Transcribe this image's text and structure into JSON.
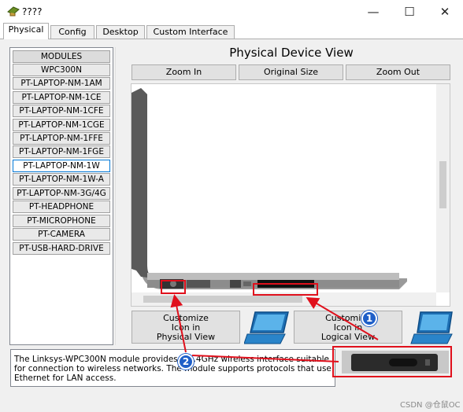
{
  "window": {
    "title": "????",
    "minimize_glyph": "—",
    "maximize_glyph": "☐",
    "close_glyph": "✕"
  },
  "tabs": [
    {
      "label": "Physical",
      "active": true
    },
    {
      "label": "Config",
      "active": false
    },
    {
      "label": "Desktop",
      "active": false
    },
    {
      "label": "Custom Interface",
      "active": false
    }
  ],
  "modules": {
    "header": "MODULES",
    "items": [
      "WPC300N",
      "PT-LAPTOP-NM-1AM",
      "PT-LAPTOP-NM-1CE",
      "PT-LAPTOP-NM-1CFE",
      "PT-LAPTOP-NM-1CGE",
      "PT-LAPTOP-NM-1FFE",
      "PT-LAPTOP-NM-1FGE",
      "PT-LAPTOP-NM-1W",
      "PT-LAPTOP-NM-1W-A",
      "PT-LAPTOP-NM-3G/4G",
      "PT-HEADPHONE",
      "PT-MICROPHONE",
      "PT-CAMERA",
      "PT-USB-HARD-DRIVE"
    ],
    "selected": "PT-LAPTOP-NM-1W"
  },
  "physical_view": {
    "title": "Physical Device View",
    "zoom_in": "Zoom In",
    "original_size": "Original Size",
    "zoom_out": "Zoom Out"
  },
  "customize": {
    "physical": {
      "line1": "Customize",
      "line2": "Icon in",
      "line3": "Physical View"
    },
    "logical": {
      "line1": "Customize",
      "line2": "Icon in",
      "line3": "Logical View"
    }
  },
  "description": "The Linksys-WPC300N module provides a 2.4GHz wireless interface suitable for connection to wireless networks. The module supports protocols that use Ethernet for LAN access.",
  "annotations": {
    "badge1": "1",
    "badge2": "2",
    "color": "#e0101c",
    "badge_color": "#1f5fc8"
  },
  "watermark": "CSDN @仓鼠OC"
}
